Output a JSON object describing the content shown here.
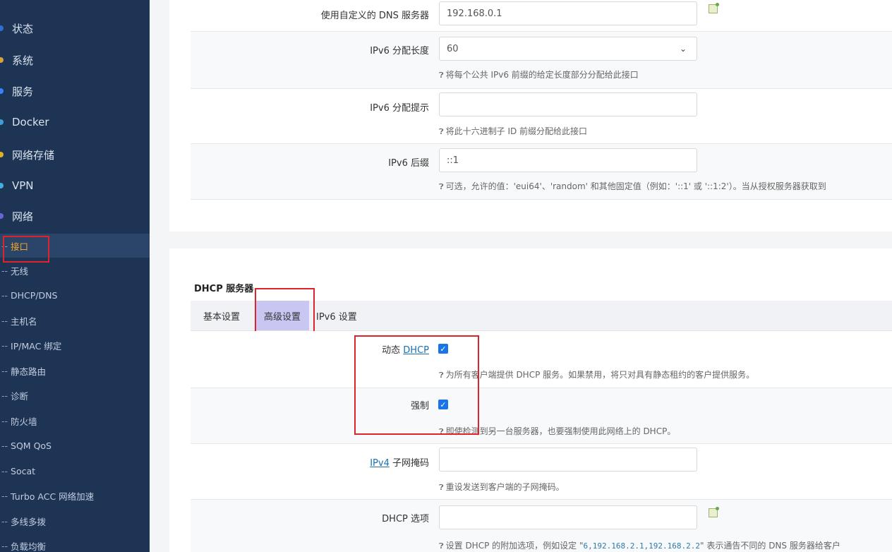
{
  "sidebar": {
    "menu": [
      {
        "label": "状态",
        "color": "#2f6fd0"
      },
      {
        "label": "系统",
        "color": "#d6a23a"
      },
      {
        "label": "服务",
        "color": "#3b82f6"
      },
      {
        "label": "Docker",
        "color": "#3aa0d6"
      },
      {
        "label": "网络存储",
        "color": "#e0b020"
      },
      {
        "label": "VPN",
        "color": "#3fb0e0"
      },
      {
        "label": "网络",
        "color": "#6c63d9"
      }
    ],
    "submenu": [
      "接口",
      "无线",
      "DHCP/DNS",
      "主机名",
      "IP/MAC 绑定",
      "静态路由",
      "诊断",
      "防火墙",
      "SQM QoS",
      "Socat",
      "Turbo ACC 网络加速",
      "多线多拨",
      "负载均衡"
    ],
    "submenu_dash": "--"
  },
  "upper": {
    "dns": {
      "label": "使用自定义的 DNS 服务器",
      "value": "192.168.0.1"
    },
    "ipv6_len": {
      "label": "IPv6 分配长度",
      "value": "60",
      "help": "将每个公共 IPv6 前缀的给定长度部分分配给此接口"
    },
    "ipv6_hint": {
      "label": "IPv6 分配提示",
      "value": "",
      "help": "将此十六进制子 ID 前缀分配给此接口"
    },
    "ipv6_suffix": {
      "label": "IPv6 后缀",
      "value": "::1",
      "help": "可选，允许的值：'eui64'、'random' 和其他固定值（例如：'::1' 或 '::1:2'）。当从授权服务器获取到"
    }
  },
  "dhcp": {
    "section_title": "DHCP 服务器",
    "tabs": [
      "基本设置",
      "高级设置",
      "IPv6 设置"
    ],
    "dynamic": {
      "label_prefix": "动态",
      "label_link": "DHCP",
      "checked": true,
      "help": "为所有客户端提供 DHCP 服务。如果禁用，将只对具有静态租约的客户提供服务。"
    },
    "force": {
      "label": "强制",
      "checked": true,
      "help": "即使检测到另一台服务器，也要强制使用此网络上的 DHCP。"
    },
    "netmask": {
      "label_link": "IPv4",
      "label_suffix": "子网掩码",
      "value": "",
      "help": "重设发送到客户端的子网掩码。"
    },
    "options": {
      "label": "DHCP 选项",
      "value": "",
      "help_prefix": "设置 DHCP 的附加选项，例如设定 \"",
      "help_code": "6,192.168.2.1,192.168.2.2",
      "help_suffix": "\" 表示通告不同的 DNS 服务器给客户"
    }
  },
  "colors": {
    "sidebar_bg": "#1e3454",
    "active_text": "#f5a623",
    "highlight_box": "#e0232a",
    "checkbox": "#1a73e8"
  },
  "icons": {
    "help": "question-circle-icon",
    "add": "add-entry-icon",
    "dropdown": "chevron-down-icon",
    "check": "checkmark-icon"
  }
}
